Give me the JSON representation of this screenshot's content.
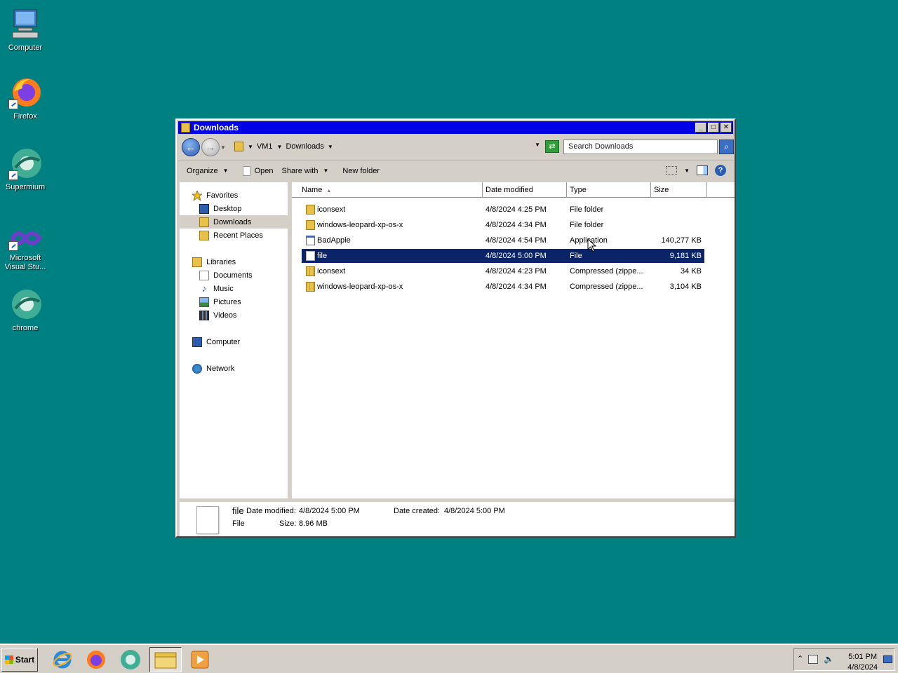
{
  "desktop": {
    "icons": [
      {
        "label": "Computer",
        "icon": "computer-icon"
      },
      {
        "label": "Firefox",
        "icon": "firefox-icon"
      },
      {
        "label": "Supermium",
        "icon": "supermium-icon"
      },
      {
        "label": "Microsoft Visual Stu...",
        "icon": "visual-studio-icon"
      },
      {
        "label": "chrome",
        "icon": "chrome-icon"
      }
    ]
  },
  "window": {
    "title": "Downloads",
    "address": {
      "crumbs": [
        "VM1",
        "Downloads"
      ]
    },
    "search": {
      "placeholder": "Search Downloads"
    },
    "toolbar": {
      "organize": "Organize",
      "open": "Open",
      "share_with": "Share with",
      "new_folder": "New folder"
    },
    "nav": {
      "favorites": "Favorites",
      "desktop": "Desktop",
      "downloads": "Downloads",
      "recent_places": "Recent Places",
      "libraries": "Libraries",
      "documents": "Documents",
      "music": "Music",
      "pictures": "Pictures",
      "videos": "Videos",
      "computer": "Computer",
      "network": "Network"
    },
    "columns": {
      "name": "Name",
      "date": "Date modified",
      "type": "Type",
      "size": "Size"
    },
    "files": [
      {
        "name": "iconsext",
        "date": "4/8/2024 4:25 PM",
        "type": "File folder",
        "size": "",
        "icon": "folder-icon"
      },
      {
        "name": "windows-leopard-xp-os-x",
        "date": "4/8/2024 4:34 PM",
        "type": "File folder",
        "size": "",
        "icon": "folder-icon"
      },
      {
        "name": "BadApple",
        "date": "4/8/2024 4:54 PM",
        "type": "Application",
        "size": "140,277 KB",
        "icon": "application-icon"
      },
      {
        "name": "file",
        "date": "4/8/2024 5:00 PM",
        "type": "File",
        "size": "9,181 KB",
        "icon": "file-icon",
        "selected": true
      },
      {
        "name": "iconsext",
        "date": "4/8/2024 4:23 PM",
        "type": "Compressed (zippe...",
        "size": "34 KB",
        "icon": "zip-icon"
      },
      {
        "name": "windows-leopard-xp-os-x",
        "date": "4/8/2024 4:34 PM",
        "type": "Compressed (zippe...",
        "size": "3,104 KB",
        "icon": "zip-icon"
      }
    ],
    "details": {
      "name": "file",
      "kind": "File",
      "date_modified_label": "Date modified:",
      "date_modified": "4/8/2024 5:00 PM",
      "size_label": "Size:",
      "size": "8.96 MB",
      "date_created_label": "Date created:",
      "date_created": "4/8/2024 5:00 PM"
    }
  },
  "taskbar": {
    "start": "Start",
    "clock": {
      "time": "5:01 PM",
      "date": "4/8/2024"
    }
  },
  "colors": {
    "desktop": "#008080",
    "titlebar": "#0000e6",
    "selection": "#0b2468"
  }
}
